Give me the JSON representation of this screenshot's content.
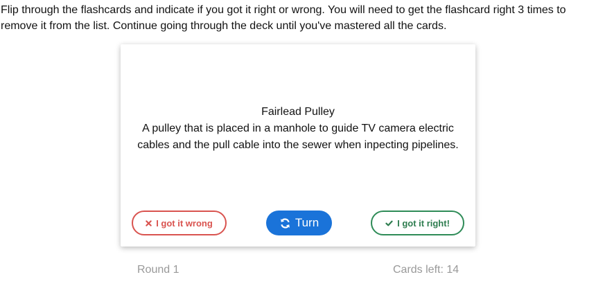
{
  "instructions": "Flip through the flashcards and indicate if you got it right or wrong. You will need to get the flashcard right 3 times to remove it from the list. Continue going through the deck until you've mastered all the cards.",
  "card": {
    "term": "Fairlead Pulley",
    "definition": "A pulley that is placed in a manhole to guide TV camera electric cables and the pull cable into the sewer when inpecting pipelines."
  },
  "buttons": {
    "wrong_label": "I got it wrong",
    "turn_label": "Turn",
    "right_label": "I got it right!"
  },
  "colors": {
    "wrong": "#d9534f",
    "turn": "#1a73d9",
    "right": "#2e8b57"
  },
  "footer": {
    "round": "Round 1",
    "cards_left": "Cards left: 14"
  }
}
